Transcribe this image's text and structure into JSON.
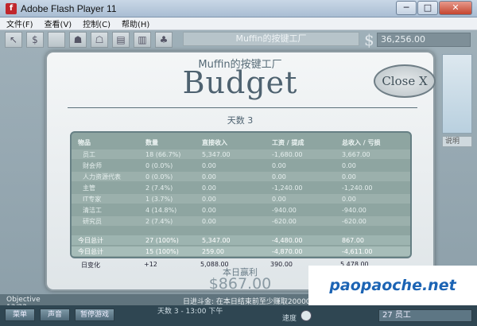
{
  "window": {
    "title": "Adobe Flash Player 11",
    "minimize": "─",
    "maximize": "□",
    "close": "✕"
  },
  "menu": [
    "文件(F)",
    "查看(V)",
    "控制(C)",
    "帮助(H)"
  ],
  "stage": {
    "factory_name_bar": "Muffin的按键工厂",
    "money_symbol": "$",
    "money": "36,256.00",
    "right_label": "说明"
  },
  "budget": {
    "factory_name": "Muffin的按键工厂",
    "title": "Budget",
    "day": "天数 3",
    "close_label": "Close X",
    "headers": [
      "物品",
      "数量",
      "直接收入",
      "工资 / 提成",
      "总收入 / 亏损"
    ],
    "rows": [
      [
        "员工",
        "18 (66.7%)",
        "5,347.00",
        "-1,680.00",
        "3,667.00"
      ],
      [
        "财会师",
        "0 (0.0%)",
        "0.00",
        "0.00",
        "0.00"
      ],
      [
        "人力资源代表",
        "0 (0.0%)",
        "0.00",
        "0.00",
        "0.00"
      ],
      [
        "主管",
        "2 (7.4%)",
        "0.00",
        "-1,240.00",
        "-1,240.00"
      ],
      [
        "IT专家",
        "1 (3.7%)",
        "0.00",
        "0.00",
        "0.00"
      ],
      [
        "清洁工",
        "4 (14.8%)",
        "0.00",
        "-940.00",
        "-940.00"
      ],
      [
        "研究员",
        "2 (7.4%)",
        "0.00",
        "-620.00",
        "-620.00"
      ]
    ],
    "today_total": [
      "今日总计",
      "27 (100%)",
      "5,347.00",
      "-4,480.00",
      "867.00"
    ],
    "today_total2": [
      "今日总计",
      "15 (100%)",
      "259.00",
      "-4,870.00",
      "-4,611.00"
    ],
    "daily_change": [
      "日变化",
      "+12",
      "5,088.00",
      "390.00",
      "5,478.00"
    ],
    "profit_label": "本日赢利",
    "profit_value": "$867.00"
  },
  "objective": {
    "label": "Objective 13/22",
    "text": "日进斗金: 在本日结束前至少赚取20000"
  },
  "bottom": {
    "menu": "菜单",
    "sound": "声音",
    "pause": "暂停游戏",
    "day": "天数 3 - 13:00 下午",
    "speed_label": "速度",
    "workers": "27 员工"
  },
  "watermark": "paopaoche.net"
}
